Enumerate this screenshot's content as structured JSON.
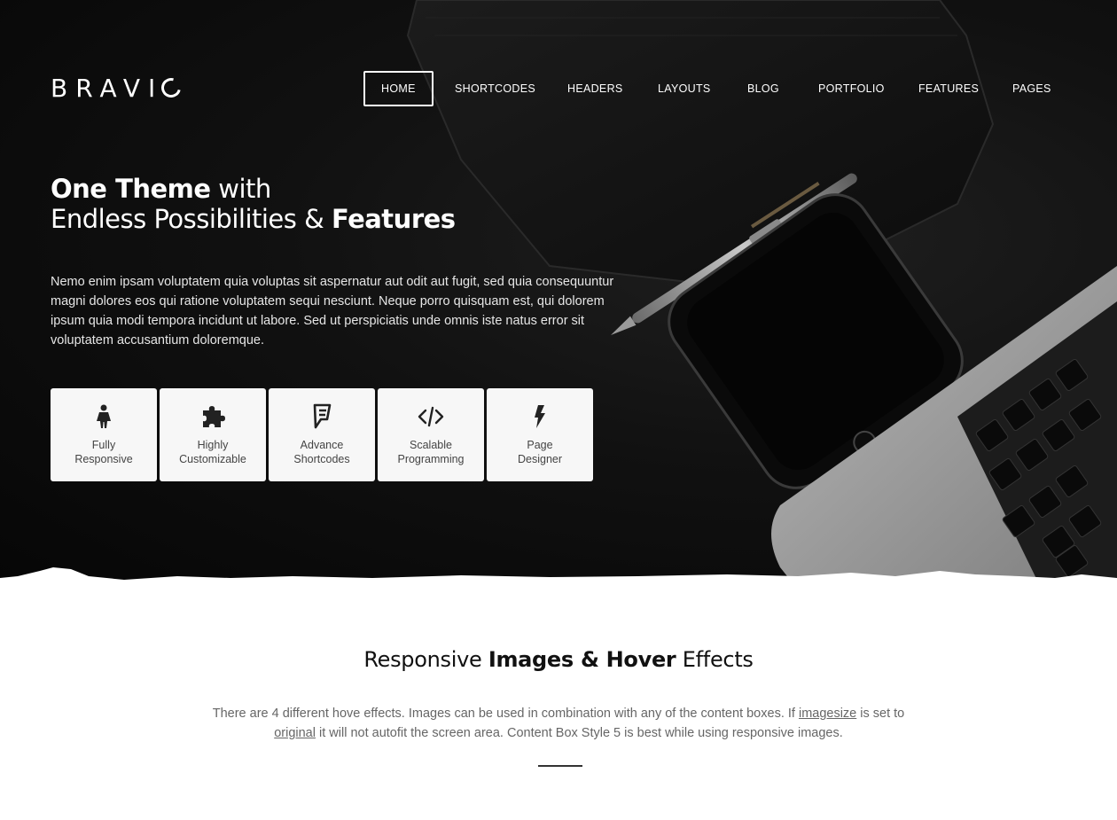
{
  "logo": "BRAVI",
  "nav": [
    {
      "label": "HOME",
      "active": true
    },
    {
      "label": "SHORTCODES"
    },
    {
      "label": "HEADERS"
    },
    {
      "label": "LAYOUTS"
    },
    {
      "label": "BLOG"
    },
    {
      "label": "PORTFOLIO"
    },
    {
      "label": "FEATURES"
    },
    {
      "label": "PAGES"
    }
  ],
  "hero": {
    "headline_line1_bold": "One Theme",
    "headline_line1_rest": " with",
    "headline_line2_start": "Endless Possibilities & ",
    "headline_line2_bold": "Features",
    "text": "Nemo enim ipsam voluptatem quia voluptas sit aspernatur aut odit aut fugit, sed quia consequuntur magni dolores eos qui ratione voluptatem sequi nesciunt. Neque porro quisquam est, qui dolorem ipsum quia modi tempora incidunt ut labore. Sed ut perspiciatis unde omnis iste natus error sit voluptatem accusantium doloremque."
  },
  "features": [
    {
      "icon": "female-icon",
      "line1": "Fully",
      "line2": "Responsive"
    },
    {
      "icon": "puzzle-icon",
      "line1": "Highly",
      "line2": "Customizable"
    },
    {
      "icon": "foursquare-icon",
      "line1": "Advance",
      "line2": "Shortcodes"
    },
    {
      "icon": "code-icon",
      "line1": "Scalable",
      "line2": "Programming"
    },
    {
      "icon": "bolt-icon",
      "line1": "Page",
      "line2": "Designer"
    }
  ],
  "section": {
    "title_start": "Responsive ",
    "title_bold": "Images & Hover",
    "title_end": " Effects",
    "text_part1": "There are 4 different hove effects. Images can be used in combination with any of the content boxes. If ",
    "link1": "imagesize",
    "text_part2": " is set to ",
    "link2": "original",
    "text_part3": " it will not autofit the screen area. Content Box Style 5 is best while using responsive images."
  },
  "colors": {
    "hero_bg": "#0b0b0b",
    "box_bg": "#f7f7f7",
    "text_light": "#ffffff",
    "text_muted": "#666666"
  }
}
